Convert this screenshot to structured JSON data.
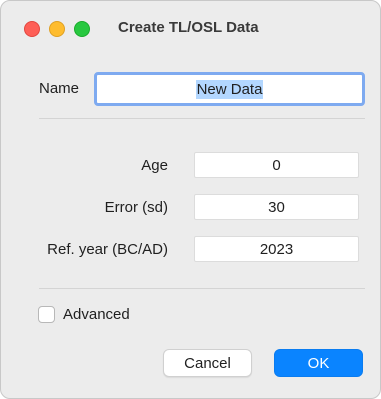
{
  "window": {
    "title": "Create TL/OSL Data",
    "colors": {
      "close": "#fe5f57",
      "minimize": "#febc2e",
      "maximize": "#28c840"
    }
  },
  "form": {
    "name_label": "Name",
    "name_value": "New Data",
    "age_label": "Age",
    "age_value": "0",
    "error_label": "Error (sd)",
    "error_value": "30",
    "refyear_label": "Ref. year (BC/AD)",
    "refyear_value": "2023",
    "advanced_label": "Advanced",
    "advanced_checked": false
  },
  "buttons": {
    "cancel_label": "Cancel",
    "ok_label": "OK",
    "accent": "#0a84ff"
  }
}
